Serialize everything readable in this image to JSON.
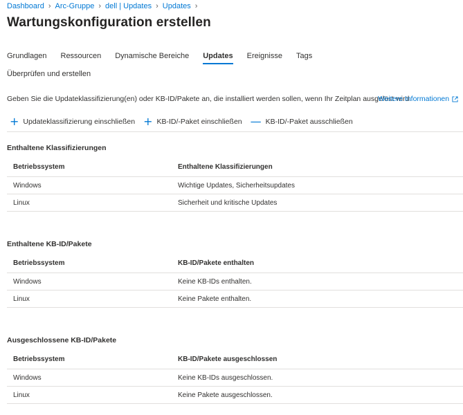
{
  "breadcrumb": [
    "Dashboard",
    "Arc-Gruppe",
    "dell | Updates",
    "Updates"
  ],
  "page_title": "Wartungskonfiguration erstellen",
  "more_label": "···",
  "tabs": [
    "Grundlagen",
    "Ressourcen",
    "Dynamische Bereiche",
    "Updates",
    "Ereignisse",
    "Tags"
  ],
  "tab_review": "Überprüfen und erstellen",
  "active_tab": "Updates",
  "description": "Geben Sie die Updateklassifizierung(en) oder KB-ID/Pakete an, die installiert werden sollen, wenn Ihr Zeitplan ausgelöst wird.",
  "more_info": "Weitere Informationen",
  "toolbar": {
    "include_class": "Updateklassifizierung einschließen",
    "include_kb": "KB-ID/-Paket einschließen",
    "exclude_kb": "KB-ID/-Paket ausschließen"
  },
  "sections": {
    "classifications": {
      "title": "Enthaltene Klassifizierungen",
      "headers": [
        "Betriebssystem",
        "Enthaltene Klassifizierungen"
      ],
      "rows": [
        [
          "Windows",
          "Wichtige Updates, Sicherheitsupdates"
        ],
        [
          "Linux",
          "Sicherheit und kritische Updates"
        ]
      ]
    },
    "included": {
      "title": "Enthaltene KB-ID/Pakete",
      "headers": [
        "Betriebssystem",
        "KB-ID/Pakete enthalten"
      ],
      "rows": [
        [
          "Windows",
          "Keine KB-IDs enthalten."
        ],
        [
          "Linux",
          "Keine Pakete enthalten."
        ]
      ]
    },
    "excluded": {
      "title": "Ausgeschlossene KB-ID/Pakete",
      "headers": [
        "Betriebssystem",
        "KB-ID/Pakete ausgeschlossen"
      ],
      "rows": [
        [
          "Windows",
          "Keine KB-IDs ausgeschlossen."
        ],
        [
          "Linux",
          "Keine Pakete ausgeschlossen."
        ]
      ]
    }
  },
  "colors": {
    "accent": "#0078d4",
    "text": "#323130",
    "divider": "#e1dfdd"
  }
}
